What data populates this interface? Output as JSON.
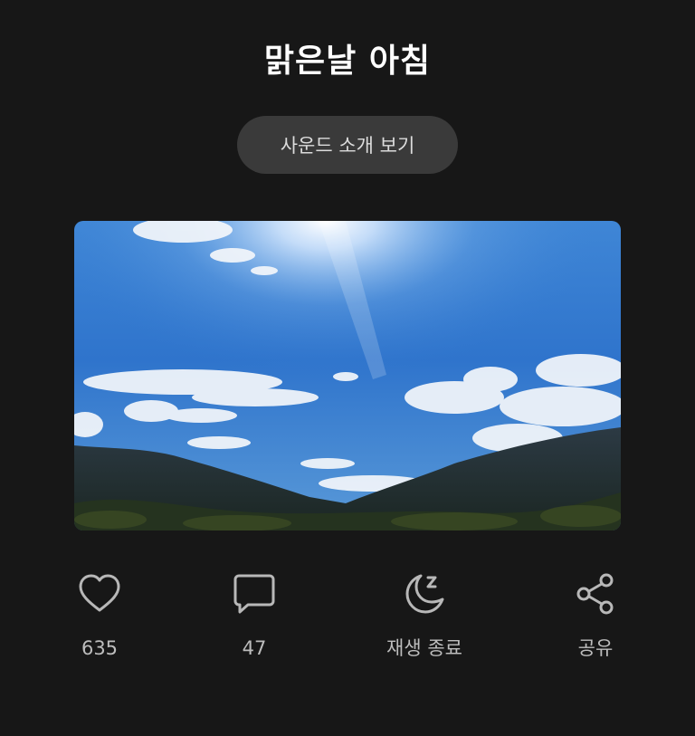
{
  "header": {
    "title": "맑은날 아침"
  },
  "intro_button": {
    "label": "사운드 소개 보기"
  },
  "artwork": {
    "description_icon": "sky-landscape-image"
  },
  "actions": [
    {
      "icon": "heart-icon",
      "label": "635"
    },
    {
      "icon": "comment-icon",
      "label": "47"
    },
    {
      "icon": "sleep-moon-icon",
      "label": "재생 종료"
    },
    {
      "icon": "share-icon",
      "label": "공유"
    }
  ],
  "colors": {
    "background": "#171717",
    "pill": "#3a3a3a",
    "icon": "#b8b8b8",
    "label": "#bdbdbd"
  }
}
